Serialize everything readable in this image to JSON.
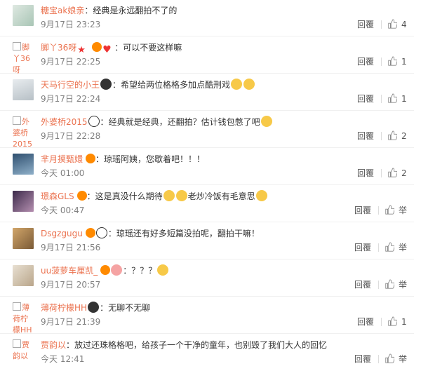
{
  "comments": [
    {
      "user": "糖宝ak娘亲",
      "text": "经典是永远翻拍不了的",
      "time": "9月17日 23:23",
      "reply": "回覆",
      "likes": "4",
      "report": ""
    },
    {
      "user": "脚丫36呀",
      "text": "可以不要这样嘛",
      "time": "9月17日 22:25",
      "reply": "回覆",
      "likes": "1",
      "report": "",
      "avatar_alt": "脚丫36呀"
    },
    {
      "user": "天马行空的小王",
      "text": "希望给两位格格多加点酷刑戏",
      "time": "9月17日 22:24",
      "reply": "回覆",
      "likes": "1",
      "report": ""
    },
    {
      "user": "外婆桥2015",
      "text": "经典就是经典，还翻拍？估计钱包憋了吧",
      "time": "9月17日 22:28",
      "reply": "回覆",
      "likes": "2",
      "report": "",
      "avatar_alt": "外婆桥2015"
    },
    {
      "user": "芈月摸甄嬛",
      "text": "琼瑶阿姨，您歇着吧！！！",
      "time": "今天 01:00",
      "reply": "回覆",
      "likes": "2",
      "report": ""
    },
    {
      "user": "璟森GLS",
      "text": "这是真没什么期待",
      "text2": "老炒冷饭有毛意思",
      "time": "今天 00:47",
      "reply": "回覆",
      "likes": "",
      "report": "举"
    },
    {
      "user": "Dsgzgugu",
      "text": "琼瑶还有好多短篇没拍呢，翻拍干嘛！",
      "time": "9月17日 21:56",
      "reply": "回覆",
      "likes": "",
      "report": "举"
    },
    {
      "user": "uu菠萝车厘凯_",
      "text": "？？？",
      "time": "9月17日 20:57",
      "reply": "回覆",
      "likes": "",
      "report": "举"
    },
    {
      "user": "薄荷柠檬HH",
      "text": "无聊不无聊",
      "time": "9月17日 21:39",
      "reply": "回覆",
      "likes": "1",
      "report": "",
      "avatar_alt": "薄荷柠檬HH"
    },
    {
      "user": "贾韵以",
      "text": "放过还珠格格吧，给孩子一个干净的童年，也别毁了我们大人的回忆",
      "time": "今天 12:41",
      "reply": "回覆",
      "likes": "",
      "report": "举",
      "avatar_alt": "贾韵以"
    }
  ],
  "colors": {
    "username": "#eb7350",
    "time": "#808080",
    "text": "#333333"
  }
}
